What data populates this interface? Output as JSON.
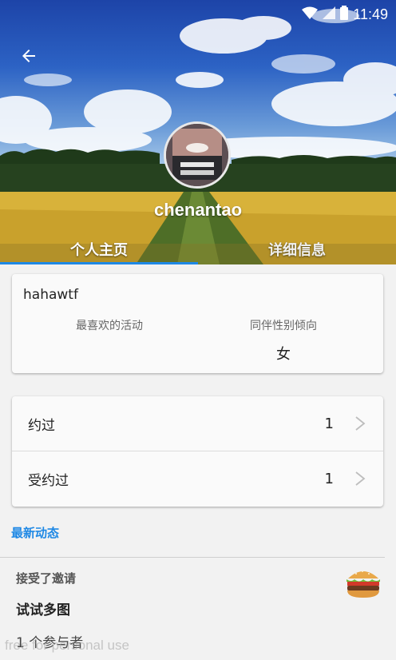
{
  "status_bar": {
    "time": "11:49"
  },
  "profile": {
    "username": "chenantao",
    "bio": "hahawtf",
    "favorite_activity_label": "最喜欢的活动",
    "favorite_activity_value": "",
    "partner_gender_label": "同伴性别倾向",
    "partner_gender_value": "女"
  },
  "tabs": [
    {
      "label": "个人主页",
      "active": true
    },
    {
      "label": "详细信息",
      "active": false
    }
  ],
  "stats": [
    {
      "label": "约过",
      "count": "1"
    },
    {
      "label": "受约过",
      "count": "1"
    }
  ],
  "feed": {
    "section_title": "最新动态",
    "items": [
      {
        "action": "接受了邀请",
        "title": "试试多图",
        "participants": "1 个参与者",
        "icon": "burger-icon"
      }
    ]
  },
  "watermark": "free for personal use",
  "colors": {
    "accent": "#1e88e5",
    "background": "#f2f2f2"
  }
}
